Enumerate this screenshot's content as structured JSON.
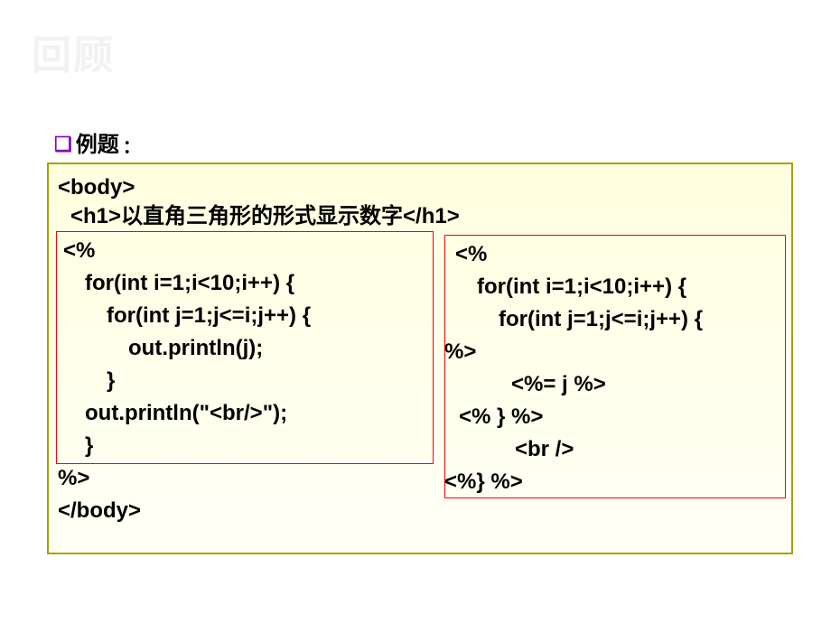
{
  "slideTitle": "回顾",
  "heading": {
    "bullet": "❑",
    "text": "例题",
    "colon": "："
  },
  "left": {
    "bodyOpen": "<body>",
    "h1": "<h1>以直角三角形的形式显示数字</h1>",
    "scriptletOpen": "<%",
    "forI": "for(int i=1;i<10;i++) {",
    "forJ": "for(int j=1;j<=i;j++) {",
    "outJ": "out.println(j);",
    "closeJ": "}",
    "outBr": "out.println(\"<br/>\");",
    "closeI": "}",
    "scriptletClose": "%>",
    "bodyClose": "</body>"
  },
  "right": {
    "scriptletOpen": "<%",
    "forI": "for(int i=1;i<10;i++) {",
    "forJ": "for(int j=1;j<=i;j++) {",
    "closeScriptlet1": "%>",
    "expr": "<%= j %>",
    "closeJ": "<% } %>",
    "br": "<br />",
    "closeI": "<%} %>"
  }
}
